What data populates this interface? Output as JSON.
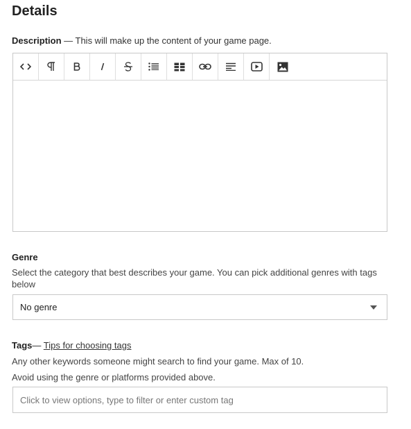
{
  "page": {
    "title": "Details"
  },
  "description": {
    "label": "Description",
    "helper": " — This will make up the content of your game page.",
    "toolbar": [
      {
        "name": "code-view-button",
        "icon": "code-icon"
      },
      {
        "name": "paragraph-button",
        "icon": "pilcrow-icon"
      },
      {
        "name": "bold-button",
        "icon": "bold-icon"
      },
      {
        "name": "italic-button",
        "icon": "italic-icon"
      },
      {
        "name": "strikethrough-button",
        "icon": "strikethrough-icon"
      },
      {
        "name": "bulleted-list-button",
        "icon": "bulleted-list-icon"
      },
      {
        "name": "table-button",
        "icon": "table-icon"
      },
      {
        "name": "link-button",
        "icon": "link-icon"
      },
      {
        "name": "align-button",
        "icon": "align-icon"
      },
      {
        "name": "video-embed-button",
        "icon": "video-icon"
      },
      {
        "name": "image-upload-button",
        "icon": "image-icon"
      }
    ]
  },
  "genre": {
    "label": "Genre",
    "help": "Select the category that best describes your game. You can pick additional genres with tags below",
    "selected": "No genre"
  },
  "tags": {
    "label": "Tags",
    "dash": "— ",
    "tips_link": "Tips for choosing tags",
    "help1": "Any other keywords someone might search to find your game. Max of 10.",
    "help2": "Avoid using the genre or platforms provided above.",
    "placeholder": "Click to view options, type to filter or enter custom tag"
  }
}
